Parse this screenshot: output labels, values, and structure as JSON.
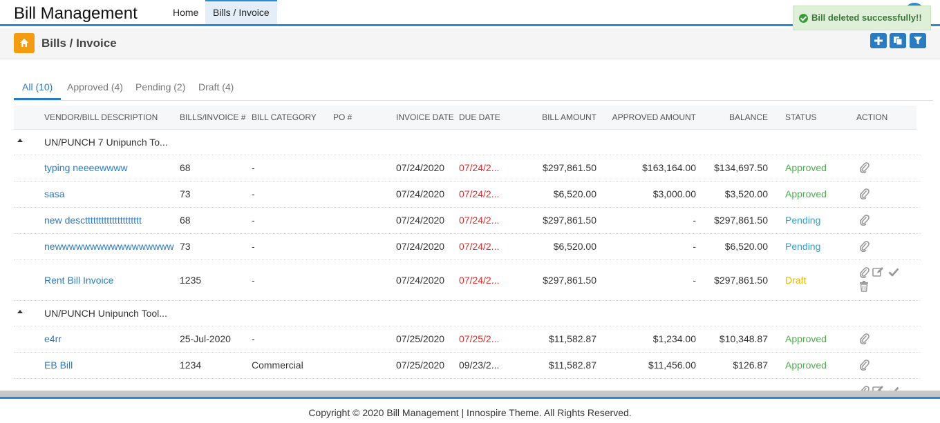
{
  "app": {
    "brand": "Bill Management"
  },
  "nav": {
    "home": "Home",
    "bills": "Bills / Invoice"
  },
  "toast": {
    "message": "Bill deleted successfully!!"
  },
  "page": {
    "title": "Bills / Invoice"
  },
  "tabs": [
    {
      "label": "All (10)"
    },
    {
      "label": "Approved (4)"
    },
    {
      "label": "Pending (2)"
    },
    {
      "label": "Draft (4)"
    }
  ],
  "columns": {
    "vendor": "VENDOR/BILL DESCRIPTION",
    "bill_no": "BILLS/INVOICE #",
    "category": "BILL CATEGORY",
    "po": "PO #",
    "invoice_date": "INVOICE DATE",
    "due_date": "DUE DATE",
    "bill_amount": "BILL AMOUNT",
    "approved_amount": "APPROVED AMOUNT",
    "balance": "BALANCE",
    "status": "STATUS",
    "action": "ACTION"
  },
  "groups": [
    {
      "vendor": "UN/PUNCH 7 Unipunch To...",
      "rows": [
        {
          "desc": "typing neeeewwww",
          "bill_no": "68",
          "category": "-",
          "invoice_date": "07/24/2020",
          "due_date": "07/24/2...",
          "bill_amount": "$297,861.50",
          "approved_amount": "$163,164.00",
          "balance": "$134,697.50",
          "status": "Approved"
        },
        {
          "desc": "sasa",
          "bill_no": "73",
          "category": "-",
          "invoice_date": "07/24/2020",
          "due_date": "07/24/2...",
          "bill_amount": "$6,520.00",
          "approved_amount": "$3,000.00",
          "balance": "$3,520.00",
          "status": "Approved"
        },
        {
          "desc": "new descttttttttttttttttttttt",
          "bill_no": "68",
          "category": "-",
          "invoice_date": "07/24/2020",
          "due_date": "07/24/2...",
          "bill_amount": "$297,861.50",
          "approved_amount": "-",
          "balance": "$297,861.50",
          "status": "Pending"
        },
        {
          "desc": "newwwwwwwwwwwwwwwww",
          "bill_no": "73",
          "category": "-",
          "invoice_date": "07/24/2020",
          "due_date": "07/24/2...",
          "bill_amount": "$6,520.00",
          "approved_amount": "-",
          "balance": "$6,520.00",
          "status": "Pending"
        },
        {
          "desc": "Rent Bill Invoice",
          "bill_no": "1235",
          "category": "-",
          "invoice_date": "07/24/2020",
          "due_date": "07/24/2...",
          "bill_amount": "$297,861.50",
          "approved_amount": "-",
          "balance": "$297,861.50",
          "status": "Draft"
        }
      ]
    },
    {
      "vendor": "UN/PUNCH Unipunch Tool...",
      "rows": [
        {
          "desc": "e4rr",
          "bill_no": "25-Jul-2020",
          "category": "-",
          "invoice_date": "07/25/2020",
          "due_date": "07/25/2...",
          "bill_amount": "$11,582.87",
          "approved_amount": "$1,234.00",
          "balance": "$10,348.87",
          "status": "Approved"
        },
        {
          "desc": "EB Bill",
          "bill_no": "1234",
          "category": "Commercial",
          "invoice_date": "07/25/2020",
          "due_date": "09/23/2...",
          "bill_amount": "$11,582.87",
          "approved_amount": "$11,456.00",
          "balance": "$126.87",
          "status": "Approved"
        }
      ]
    }
  ],
  "footer": {
    "text": "Copyright © 2020 Bill Management | Innospire Theme. All Rights Reserved."
  },
  "colors": {
    "accent": "#2b8ad6",
    "approved": "#4cae4c",
    "pending": "#26a6d8",
    "draft": "#e6b800",
    "overdue": "#e02b2b",
    "home_button": "#f39c12"
  },
  "icons": {
    "home": "home-icon",
    "add": "plus-icon",
    "copy": "copy-icon",
    "filter": "filter-icon",
    "attach": "paperclip-icon",
    "edit": "edit-icon",
    "approve": "check-icon",
    "delete": "trash-icon"
  }
}
